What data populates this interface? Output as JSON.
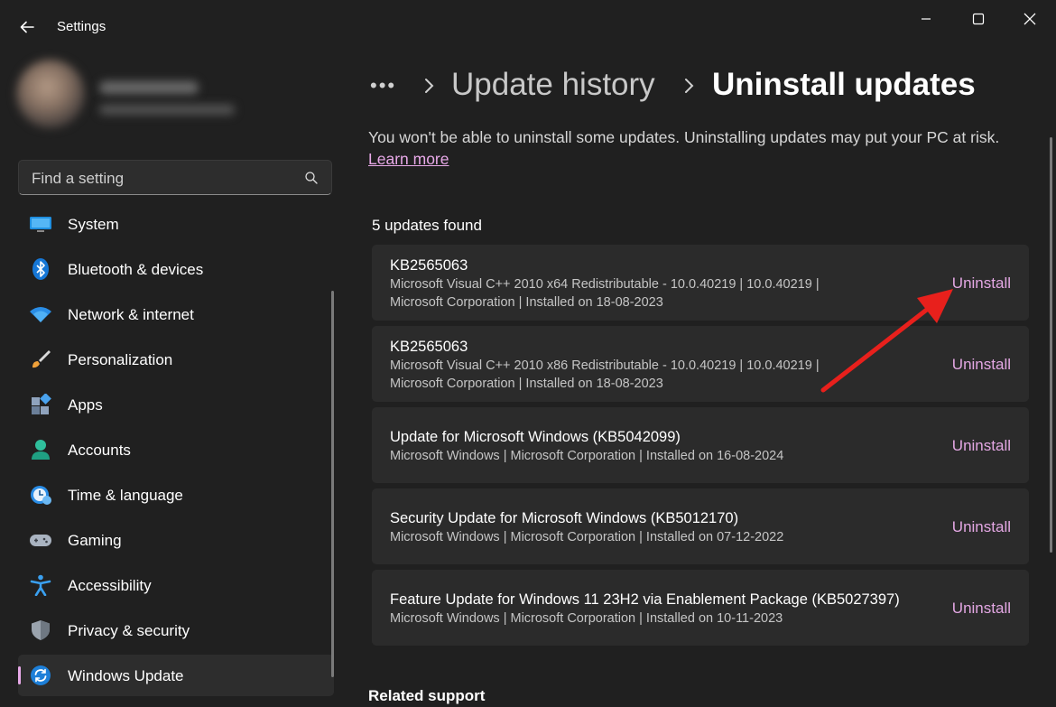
{
  "window": {
    "title": "Settings"
  },
  "search": {
    "placeholder": "Find a setting"
  },
  "sidebar": {
    "items": [
      {
        "label": "System",
        "icon": "monitor-icon"
      },
      {
        "label": "Bluetooth & devices",
        "icon": "bluetooth-icon"
      },
      {
        "label": "Network & internet",
        "icon": "wifi-icon"
      },
      {
        "label": "Personalization",
        "icon": "brush-icon"
      },
      {
        "label": "Apps",
        "icon": "apps-icon"
      },
      {
        "label": "Accounts",
        "icon": "person-icon"
      },
      {
        "label": "Time & language",
        "icon": "clock-globe-icon"
      },
      {
        "label": "Gaming",
        "icon": "gamepad-icon"
      },
      {
        "label": "Accessibility",
        "icon": "accessibility-icon"
      },
      {
        "label": "Privacy & security",
        "icon": "shield-icon"
      },
      {
        "label": "Windows Update",
        "icon": "update-icon",
        "active": true
      }
    ]
  },
  "breadcrumb": {
    "more": "•••",
    "parent": "Update history",
    "current": "Uninstall updates"
  },
  "main": {
    "warning": "You won't be able to uninstall some updates. Uninstalling updates may put your PC at risk.",
    "learn_more": "Learn more",
    "found_text": "5 updates found",
    "action_label": "Uninstall",
    "updates": [
      {
        "title": "KB2565063",
        "line1": "Microsoft Visual C++ 2010  x64 Redistributable - 10.0.40219   |   10.0.40219   |",
        "line2": "Microsoft Corporation   |   Installed on 18-08-2023"
      },
      {
        "title": "KB2565063",
        "line1": "Microsoft Visual C++ 2010  x86 Redistributable - 10.0.40219   |   10.0.40219   |",
        "line2": "Microsoft Corporation   |   Installed on 18-08-2023"
      },
      {
        "title": "Update for Microsoft Windows (KB5042099)",
        "line1": "Microsoft Windows   |   Microsoft Corporation   |   Installed on 16-08-2024"
      },
      {
        "title": "Security Update for Microsoft Windows (KB5012170)",
        "line1": "Microsoft Windows   |   Microsoft Corporation   |   Installed on 07-12-2022"
      },
      {
        "title": "Feature Update for Windows 11 23H2 via Enablement Package (KB5027397)",
        "line1": "Microsoft Windows   |   Microsoft Corporation   |   Installed on 10-11-2023"
      }
    ],
    "related": "Related support"
  },
  "colors": {
    "background": "#202020",
    "card": "#2b2b2b",
    "accent": "#e3a7e3",
    "annotation_arrow": "#e8201c"
  }
}
